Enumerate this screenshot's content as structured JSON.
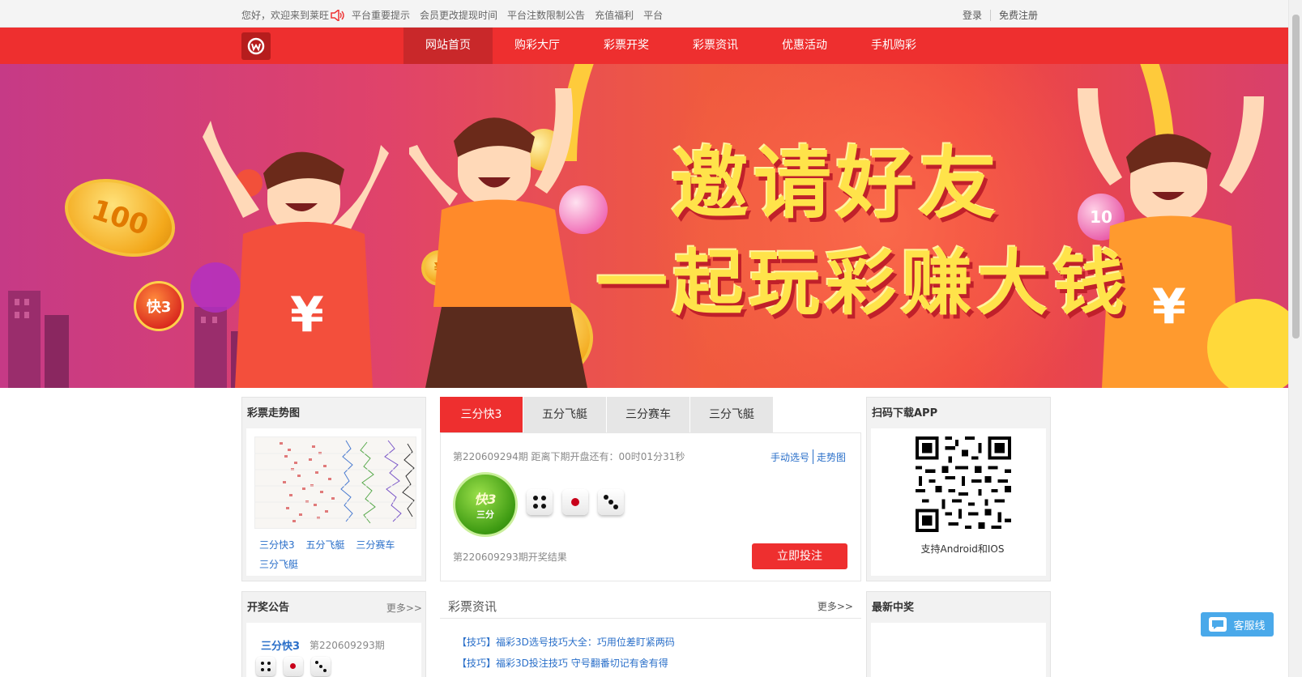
{
  "topbar": {
    "welcome": "您好，欢迎来到莱旺",
    "notices": [
      "平台重要提示",
      "会员更改提现时间",
      "平台注数限制公告",
      "充值福利",
      "平台"
    ],
    "login": "登录",
    "register": "免费注册"
  },
  "nav": {
    "items": [
      "网站首页",
      "购彩大厅",
      "彩票开奖",
      "彩票资讯",
      "优惠活动",
      "手机购彩"
    ],
    "active": "网站首页"
  },
  "banner": {
    "title": "邀请好友",
    "subtitle": "一起玩彩赚大钱",
    "coin_label": "100",
    "ball_label": "10",
    "badge_label": "快3"
  },
  "trend": {
    "title": "彩票走势图",
    "links": [
      "三分快3",
      "五分飞艇",
      "三分赛车",
      "三分飞艇"
    ]
  },
  "lottery": {
    "tabs": [
      "三分快3",
      "五分飞艇",
      "三分赛车",
      "三分飞艇"
    ],
    "active_tab": "三分快3",
    "issue_text": "第220609294期 距离下期开盘还有：00时01分31秒",
    "manual_pick": "手动选号",
    "trend_link": "走势图",
    "logo_top": "快3",
    "logo_bottom": "三分",
    "dice": [
      4,
      1,
      3
    ],
    "last_result": "第220609293期开奖结果",
    "bet_button": "立即投注"
  },
  "app": {
    "title": "扫码下载APP",
    "caption": "支持Android和IOS"
  },
  "draw_notice": {
    "title": "开奖公告",
    "more": "更多>>",
    "game": "三分快3",
    "issue": "第220609293期",
    "dice": [
      4,
      1,
      3
    ]
  },
  "news": {
    "title": "彩票资讯",
    "more": "更多>>",
    "items": [
      "【技巧】福彩3D选号技巧大全：巧用位差盯紧两码",
      "【技巧】福彩3D投注技巧 守号翻番切记有舍有得"
    ]
  },
  "winners": {
    "title": "最新中奖"
  },
  "service": {
    "label": "客服线"
  },
  "colors": {
    "brand_red": "#ee2f2f",
    "nav_active": "#c9282a",
    "link_blue": "#2a6fc9",
    "banner_yellow": "#ffe34a",
    "service_blue": "#4aa9ea"
  }
}
